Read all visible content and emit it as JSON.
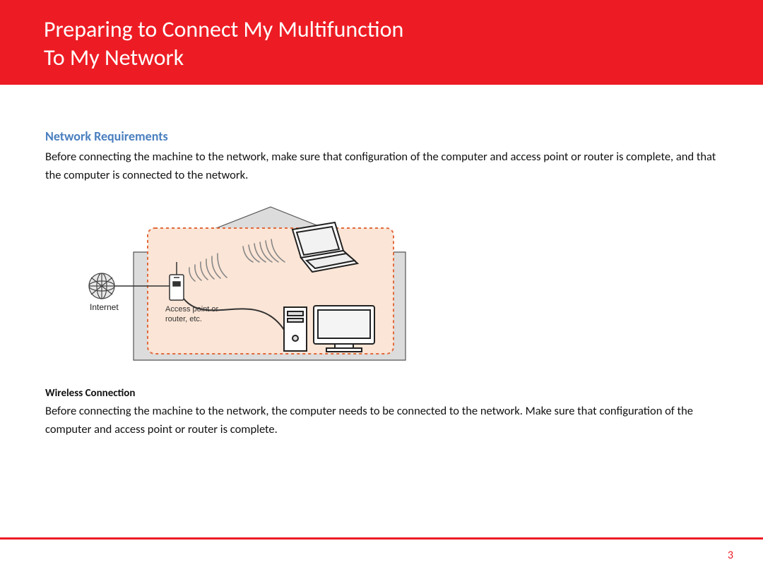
{
  "header": {
    "title_line1": "Preparing to Connect My Multifunction",
    "title_line2": "To My Network"
  },
  "section": {
    "heading": "Network Requirements",
    "intro": "Before connecting the machine to the network, make sure that configuration of the computer and access point or router is complete, and that the computer is connected to the network."
  },
  "diagram": {
    "internet_label": "Internet",
    "ap_label_line1": "Access point or",
    "ap_label_line2": "router, etc."
  },
  "wireless": {
    "heading": "Wireless Connection",
    "body": "Before connecting the machine to the network, the computer needs to be connected to the network. Make sure that configuration of the computer and access point or router is complete."
  },
  "page": {
    "number": "3"
  }
}
